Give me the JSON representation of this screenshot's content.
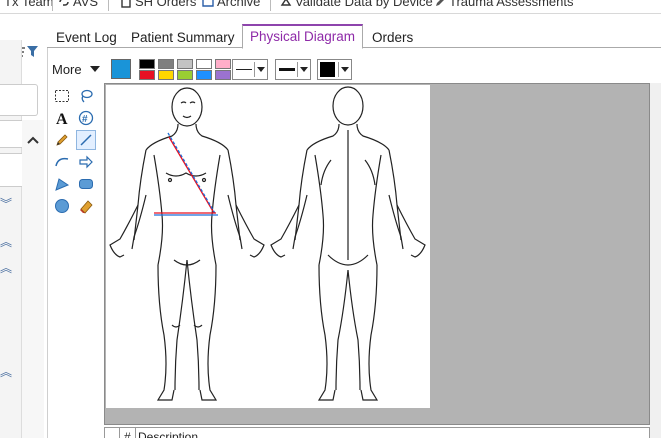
{
  "topbar": {
    "items": [
      "Tx Team",
      "AVS",
      "SH Orders",
      "Archive",
      "Validate Data by Device",
      "Trauma Assessments"
    ]
  },
  "tabs": [
    {
      "label": "Event Log",
      "active": false
    },
    {
      "label": "Patient Summary",
      "active": false
    },
    {
      "label": "Physical Diagram",
      "active": true
    },
    {
      "label": "Orders",
      "active": false
    }
  ],
  "drawbar": {
    "more_label": "More",
    "current_color": "#1a94d8",
    "palette_top": [
      "#000000",
      "#7f7f7f",
      "#c3c3c3",
      "#ffffff",
      "#ffaec9"
    ],
    "palette_bottom": [
      "#e81123",
      "#ffd700",
      "#9acd32",
      "#1e90ff",
      "#9b72cf"
    ]
  },
  "tools": [
    "select-rect-icon",
    "lasso-icon",
    "text-icon",
    "number-icon",
    "pencil-icon",
    "line-icon",
    "arc-icon",
    "arrow-icon",
    "polygon-icon",
    "rounded-rect-icon",
    "ellipse-icon",
    "eraser-icon"
  ],
  "table": {
    "col_num": "#",
    "col_desc": "Description"
  },
  "colors": {
    "accent": "#8e44ad",
    "canvas_bg": "#b3b3b3"
  }
}
